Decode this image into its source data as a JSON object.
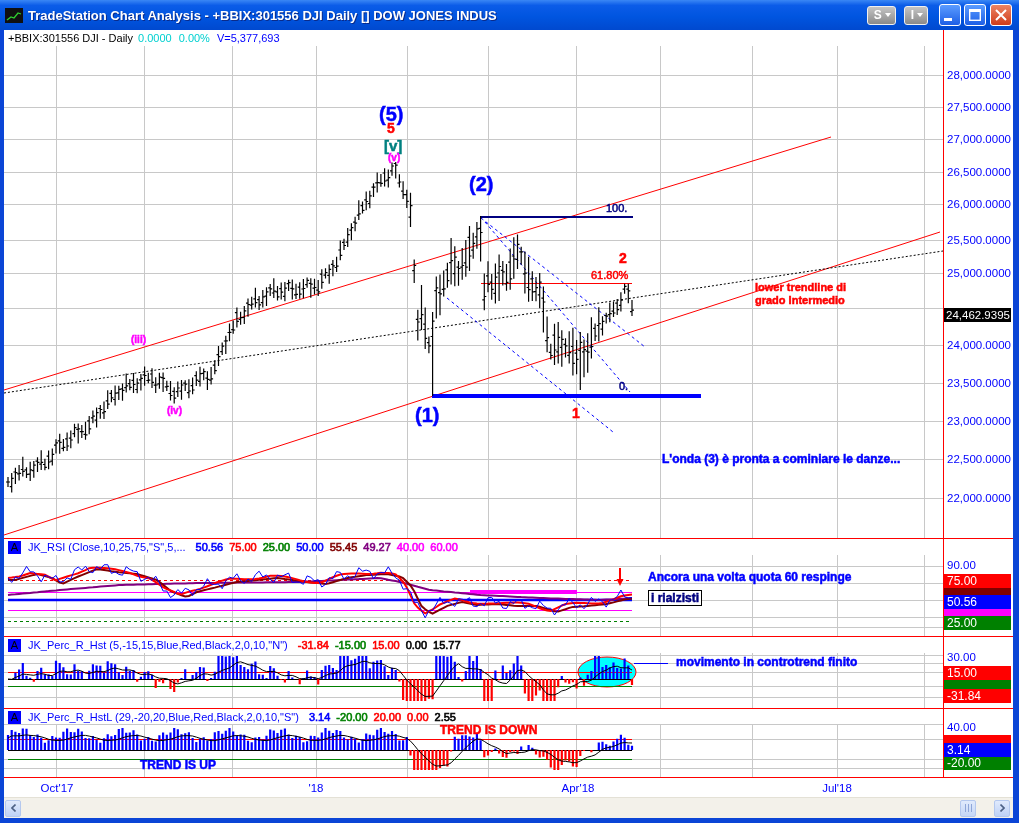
{
  "window": {
    "title": "TradeStation Chart Analysis - +BBIX:301556 DJI Daily [] DOW JONES INDUS",
    "menu_buttons": [
      "S",
      "I"
    ]
  },
  "symbol_header": {
    "symbol": "+BBIX:301556 DJI - Daily",
    "net_change": "0.0000",
    "percent_change": "0.00%",
    "volume": "V=5,377,693"
  },
  "price_panel": {
    "price_axis": [
      "28,000.0000",
      "27,500.0000",
      "27,000.0000",
      "26,500.0000",
      "26,000.0000",
      "25,500.0000",
      "25,000.0000",
      "24,000.0000",
      "23,500.0000",
      "23,000.0000",
      "22,500.0000",
      "22,000.0000"
    ],
    "last_price": "24,462.9395",
    "annotations": [
      {
        "text": "(5)",
        "kind": "wave-major",
        "color": "#0000ff"
      },
      {
        "text": "5",
        "kind": "wave-minor",
        "color": "#ff0000"
      },
      {
        "text": "[v]",
        "kind": "wave-intermediate",
        "color": "#008080"
      },
      {
        "text": "(v)",
        "kind": "wave-sub",
        "color": "#ff00ff"
      },
      {
        "text": "(2)",
        "kind": "wave-major",
        "color": "#0000ff"
      },
      {
        "text": "100.",
        "kind": "fib-label",
        "color": "#000080"
      },
      {
        "text": "2",
        "kind": "wave-minor",
        "color": "#ff0000"
      },
      {
        "text": "61.80%",
        "kind": "fib-label",
        "color": "#ff0000"
      },
      {
        "text": "lower trendline di\ngrado Intermedio",
        "kind": "note-small",
        "color": "#ff0000"
      },
      {
        "text": "(iii)",
        "kind": "wave-sub",
        "color": "#ff00ff"
      },
      {
        "text": "0.",
        "kind": "fib-label",
        "color": "#000080"
      },
      {
        "text": "(iv)",
        "kind": "wave-sub",
        "color": "#ff00ff"
      },
      {
        "text": "(1)",
        "kind": "wave-major",
        "color": "#0000ff"
      },
      {
        "text": "1",
        "kind": "wave-minor",
        "color": "#ff0000"
      },
      {
        "text": "L'onda (3) è pronta a cominiare le danze...",
        "kind": "note",
        "color": "#0000ff"
      }
    ]
  },
  "indicators": [
    {
      "kind": "rsi",
      "badge": "A",
      "title": "JK_RSI (Close,10,25,75,\"S\",5,...",
      "readouts": [
        {
          "text": "50.56",
          "color": "#0000ff"
        },
        {
          "text": "75.00",
          "color": "#ff0000"
        },
        {
          "text": "25.00",
          "color": "#008000"
        },
        {
          "text": "50.00",
          "color": "#0000ff"
        },
        {
          "text": "55.45",
          "color": "#800000"
        },
        {
          "text": "49.27",
          "color": "#800080"
        },
        {
          "text": "40.00",
          "color": "#ff00ff"
        },
        {
          "text": "60.00",
          "color": "#ff00ff"
        }
      ],
      "axis": [
        {
          "kind": "tick",
          "text": "90.00"
        },
        {
          "kind": "tag",
          "text": "75.00",
          "color": "#ff0000"
        },
        {
          "kind": "strip",
          "color": "#800000"
        },
        {
          "kind": "tag",
          "text": "50.56",
          "color": "#0000ff"
        },
        {
          "kind": "strip",
          "color": "#ff00ff"
        },
        {
          "kind": "tag",
          "text": "25.00",
          "color": "#008000"
        }
      ],
      "annotations": [
        {
          "text": "Ancora una volta quota 60 respinge",
          "kind": "note",
          "color": "#0000ff"
        },
        {
          "text": "i rialzisti",
          "kind": "boxed-note",
          "color": "#000080"
        }
      ]
    },
    {
      "kind": "histogram",
      "badge": "A",
      "title": "JK_Perc_R_Hst (5,-15,15,Blue,Red,Black,2,0,10,\"N\")",
      "readouts": [
        {
          "text": "-31.84",
          "color": "#ff0000"
        },
        {
          "text": "-15.00",
          "color": "#008000"
        },
        {
          "text": "15.00",
          "color": "#ff0000"
        },
        {
          "text": "0.00",
          "color": "#000000"
        },
        {
          "text": "15.77",
          "color": "#000000"
        }
      ],
      "axis": [
        {
          "kind": "tick",
          "text": "30.00"
        },
        {
          "kind": "tag",
          "text": "15.00",
          "color": "#ff0000"
        },
        {
          "kind": "strip",
          "color": "#008000"
        },
        {
          "kind": "tag",
          "text": "-31.84",
          "color": "#ff0000"
        }
      ],
      "annotations": [
        {
          "text": "movimento in controtrend finito",
          "kind": "note",
          "color": "#0000ff"
        }
      ]
    },
    {
      "kind": "histogram",
      "badge": "A",
      "title": "JK_Perc_R_HstL (29,-20,20,Blue,Red,Black,2,0,10,\"S\")",
      "readouts": [
        {
          "text": "3.14",
          "color": "#0000ff"
        },
        {
          "text": "-20.00",
          "color": "#008000"
        },
        {
          "text": "20.00",
          "color": "#ff0000"
        },
        {
          "text": "0.00",
          "color": "#ff0000"
        },
        {
          "text": "2.55",
          "color": "#000000"
        }
      ],
      "axis": [
        {
          "kind": "tick",
          "text": "40.00"
        },
        {
          "kind": "strip",
          "color": "#ff0000"
        },
        {
          "kind": "tag",
          "text": "3.14",
          "color": "#0000ff"
        },
        {
          "kind": "tag",
          "text": "-20.00",
          "color": "#008000"
        }
      ],
      "annotations": [
        {
          "text": "TREND IS DOWN",
          "kind": "note",
          "color": "#ff0000"
        },
        {
          "text": "TREND IS UP",
          "kind": "note",
          "color": "#0000ff"
        }
      ]
    }
  ],
  "time_axis": [
    "Oct'17",
    "'18",
    "Apr'18",
    "Jul'18"
  ]
}
